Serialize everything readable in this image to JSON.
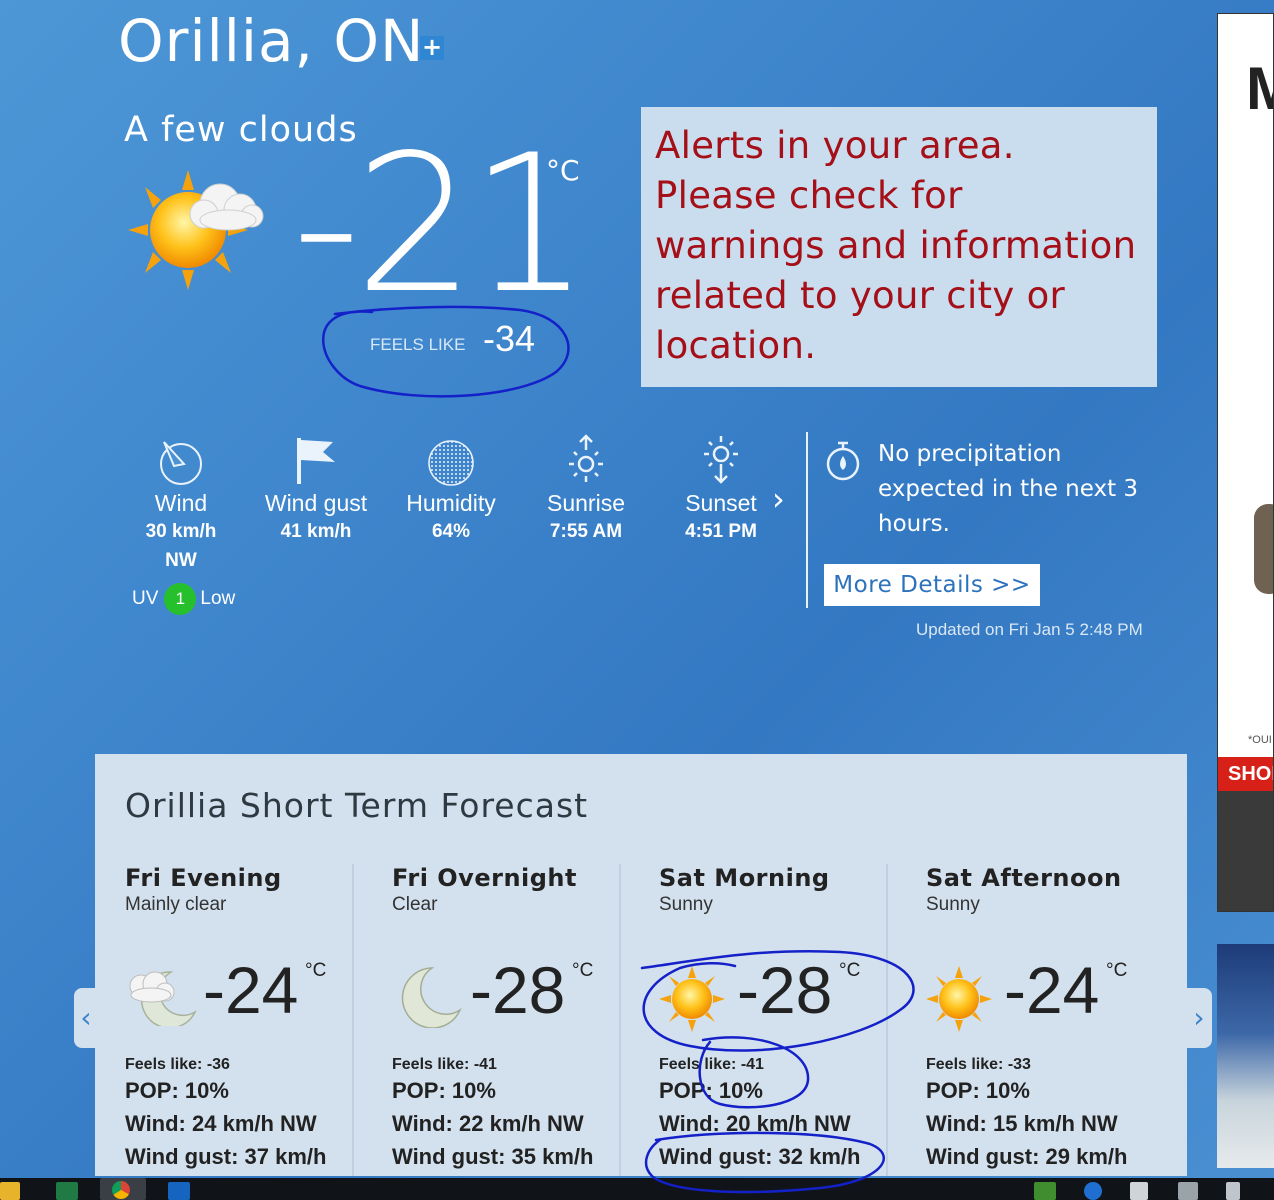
{
  "header": {
    "city": "Orillia, ON",
    "add_label": "+"
  },
  "current": {
    "condition": "A few clouds",
    "temperature": "-21",
    "unit": "°C",
    "feels_like_label": "FEELS LIKE",
    "feels_like_value": "-34",
    "icon": "sun-cloud-icon"
  },
  "alert": {
    "text": "Alerts in your area. Please check for warnings and information related to your city or location.",
    "color": "#a50f17"
  },
  "stats": [
    {
      "label": "Wind",
      "value": "30 km/h",
      "value2": "NW",
      "icon": "wind-dial-icon"
    },
    {
      "label": "Wind gust",
      "value": "41 km/h",
      "icon": "flag-icon"
    },
    {
      "label": "Humidity",
      "value": "64%",
      "icon": "humidity-icon"
    },
    {
      "label": "Sunrise",
      "value": "7:55 AM",
      "icon": "sunrise-icon"
    },
    {
      "label": "Sunset",
      "value": "4:51 PM",
      "icon": "sunset-icon"
    }
  ],
  "uv": {
    "label": "UV",
    "index": "1",
    "level": "Low",
    "color": "#27c02d"
  },
  "precipitation": {
    "text": "No precipitation expected in the next 3 hours.",
    "button": "More Details >>",
    "icon": "stopwatch-drop-icon"
  },
  "updated": "Updated on Fri Jan 5 2:48 PM",
  "ads": {
    "headline_fragment": "M",
    "fine_print": "*OUI",
    "cta": "SHOP"
  },
  "forecast": {
    "title": "Orillia Short Term Forecast",
    "periods": [
      {
        "name": "Fri Evening",
        "condition": "Mainly clear",
        "temp": "-24",
        "unit": "°C",
        "feels": "Feels like: -36",
        "pop": "POP: 10%",
        "wind": "Wind: 24 km/h NW",
        "gust": "Wind gust: 37 km/h",
        "icon": "moon-cloud-icon"
      },
      {
        "name": "Fri Overnight",
        "condition": "Clear",
        "temp": "-28",
        "unit": "°C",
        "feels": "Feels like: -41",
        "pop": "POP: 10%",
        "wind": "Wind: 22 km/h NW",
        "gust": "Wind gust: 35 km/h",
        "icon": "moon-icon"
      },
      {
        "name": "Sat Morning",
        "condition": "Sunny",
        "temp": "-28",
        "unit": "°C",
        "feels": "Feels like: -41",
        "pop": "POP: 10%",
        "wind": "Wind: 20 km/h NW",
        "gust": "Wind gust: 32 km/h",
        "icon": "sun-icon"
      },
      {
        "name": "Sat Afternoon",
        "condition": "Sunny",
        "temp": "-24",
        "unit": "°C",
        "feels": "Feels like: -33",
        "pop": "POP: 10%",
        "wind": "Wind: 15 km/h NW",
        "gust": "Wind gust: 29 km/h",
        "icon": "sun-icon"
      }
    ]
  }
}
